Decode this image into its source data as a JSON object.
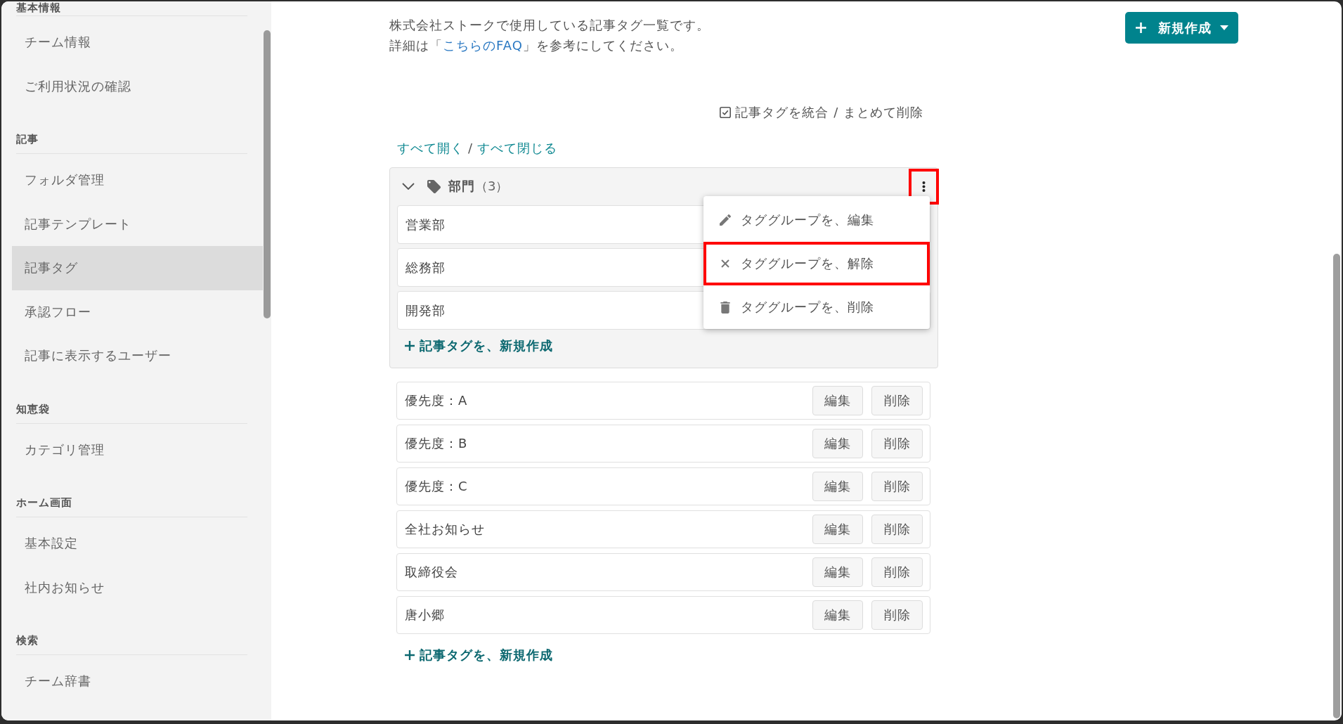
{
  "sidebar": {
    "sections": [
      {
        "heading": "基本情報",
        "items": [
          {
            "label": "チーム情報",
            "selected": false
          },
          {
            "label": "ご利用状況の確認",
            "selected": false
          }
        ]
      },
      {
        "heading": "記事",
        "items": [
          {
            "label": "フォルダ管理",
            "selected": false
          },
          {
            "label": "記事テンプレート",
            "selected": false
          },
          {
            "label": "記事タグ",
            "selected": true
          },
          {
            "label": "承認フロー",
            "selected": false
          },
          {
            "label": "記事に表示するユーザー",
            "selected": false
          }
        ]
      },
      {
        "heading": "知恵袋",
        "items": [
          {
            "label": "カテゴリ管理",
            "selected": false
          }
        ]
      },
      {
        "heading": "ホーム画面",
        "items": [
          {
            "label": "基本設定",
            "selected": false
          },
          {
            "label": "社内お知らせ",
            "selected": false
          }
        ]
      },
      {
        "heading": "検索",
        "items": [
          {
            "label": "チーム辞書",
            "selected": false
          }
        ]
      }
    ]
  },
  "intro": {
    "text": "株式会社ストークで使用している記事タグ一覧です。",
    "note_before_link": "詳細は「",
    "link": "こちらのFAQ",
    "note_after_link": "」を参考にしてください。"
  },
  "create_button": {
    "label": "新規作成"
  },
  "bulk_action": {
    "label": "記事タグを統合 / まとめて削除"
  },
  "expand_controls": {
    "expand_all": "すべて開く",
    "separator": "/",
    "collapse_all": "すべて閉じる"
  },
  "tag_groups": [
    {
      "name": "部門",
      "count": "（3）",
      "expanded": true,
      "menu_button_highlighted": true,
      "tags": [
        {
          "name": "営業部"
        },
        {
          "name": "総務部"
        },
        {
          "name": "開発部"
        }
      ],
      "add_label": "記事タグを、新規作成",
      "menu": {
        "open": true,
        "items": [
          {
            "kind": "edit",
            "label": "タググループを、編集",
            "highlighted": false
          },
          {
            "kind": "unlink",
            "label": "タググループを、解除",
            "highlighted": true
          },
          {
            "kind": "delete",
            "label": "タググループを、削除",
            "highlighted": false
          }
        ]
      }
    }
  ],
  "ungrouped_tags": [
    {
      "name": "優先度：A",
      "edit_label": "編集",
      "delete_label": "削除"
    },
    {
      "name": "優先度：B",
      "edit_label": "編集",
      "delete_label": "削除"
    },
    {
      "name": "優先度：C",
      "edit_label": "編集",
      "delete_label": "削除"
    },
    {
      "name": "全社お知らせ",
      "edit_label": "編集",
      "delete_label": "削除"
    },
    {
      "name": "取締役会",
      "edit_label": "編集",
      "delete_label": "削除"
    },
    {
      "name": "唐小郷",
      "edit_label": "編集",
      "delete_label": "削除"
    }
  ],
  "add_tag_label": "記事タグを、新規作成"
}
